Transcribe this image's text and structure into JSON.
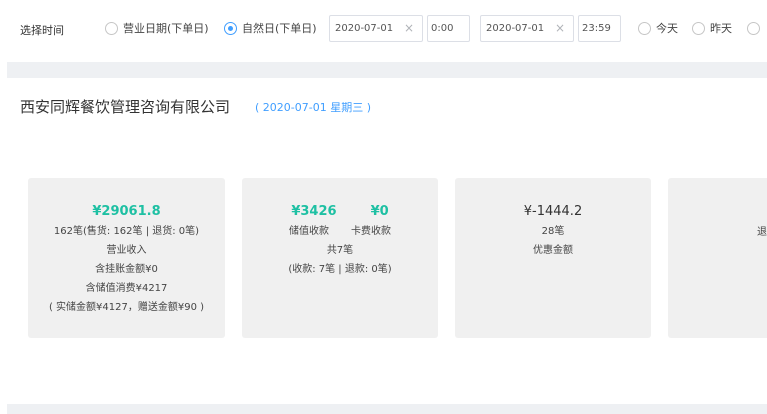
{
  "filter": {
    "label": "选择时间",
    "radio_business": "营业日期(下单日)",
    "radio_natural": "自然日(下单日)",
    "start_date": "2020-07-01",
    "start_time": "0:00",
    "end_date": "2020-07-01",
    "end_time": "23:59",
    "radio_today": "今天",
    "radio_yesterday": "昨天",
    "clear_glyph": "×"
  },
  "header": {
    "company": "西安同辉餐饮管理咨询有限公司",
    "date": "( 2020-07-01 星期三 )"
  },
  "cards": {
    "revenue": {
      "amount": "¥29061.8",
      "count": "162笔(售货: 162笔 | 退货: 0笔)",
      "label": "营业收入",
      "credit": "含挂账金额¥0",
      "stored": "含储值消费¥4217",
      "stored_detail": "( 实储金额¥4127，赠送金额¥90 )"
    },
    "stored_value": {
      "stored_amount": "¥3426",
      "card_amount": "¥0",
      "stored_label": "储值收款",
      "card_label": "卡费收款",
      "total": "共7笔",
      "detail": "(收款: 7笔 | 退款: 0笔)"
    },
    "discount": {
      "amount": "¥-1444.2",
      "count": "28笔",
      "label": "优惠金额"
    },
    "refund": {
      "label_partial": "退"
    }
  },
  "colors": {
    "accent_blue": "#409eff",
    "amount_green": "#1ec0a3",
    "card_bg": "#f0f0f0"
  }
}
